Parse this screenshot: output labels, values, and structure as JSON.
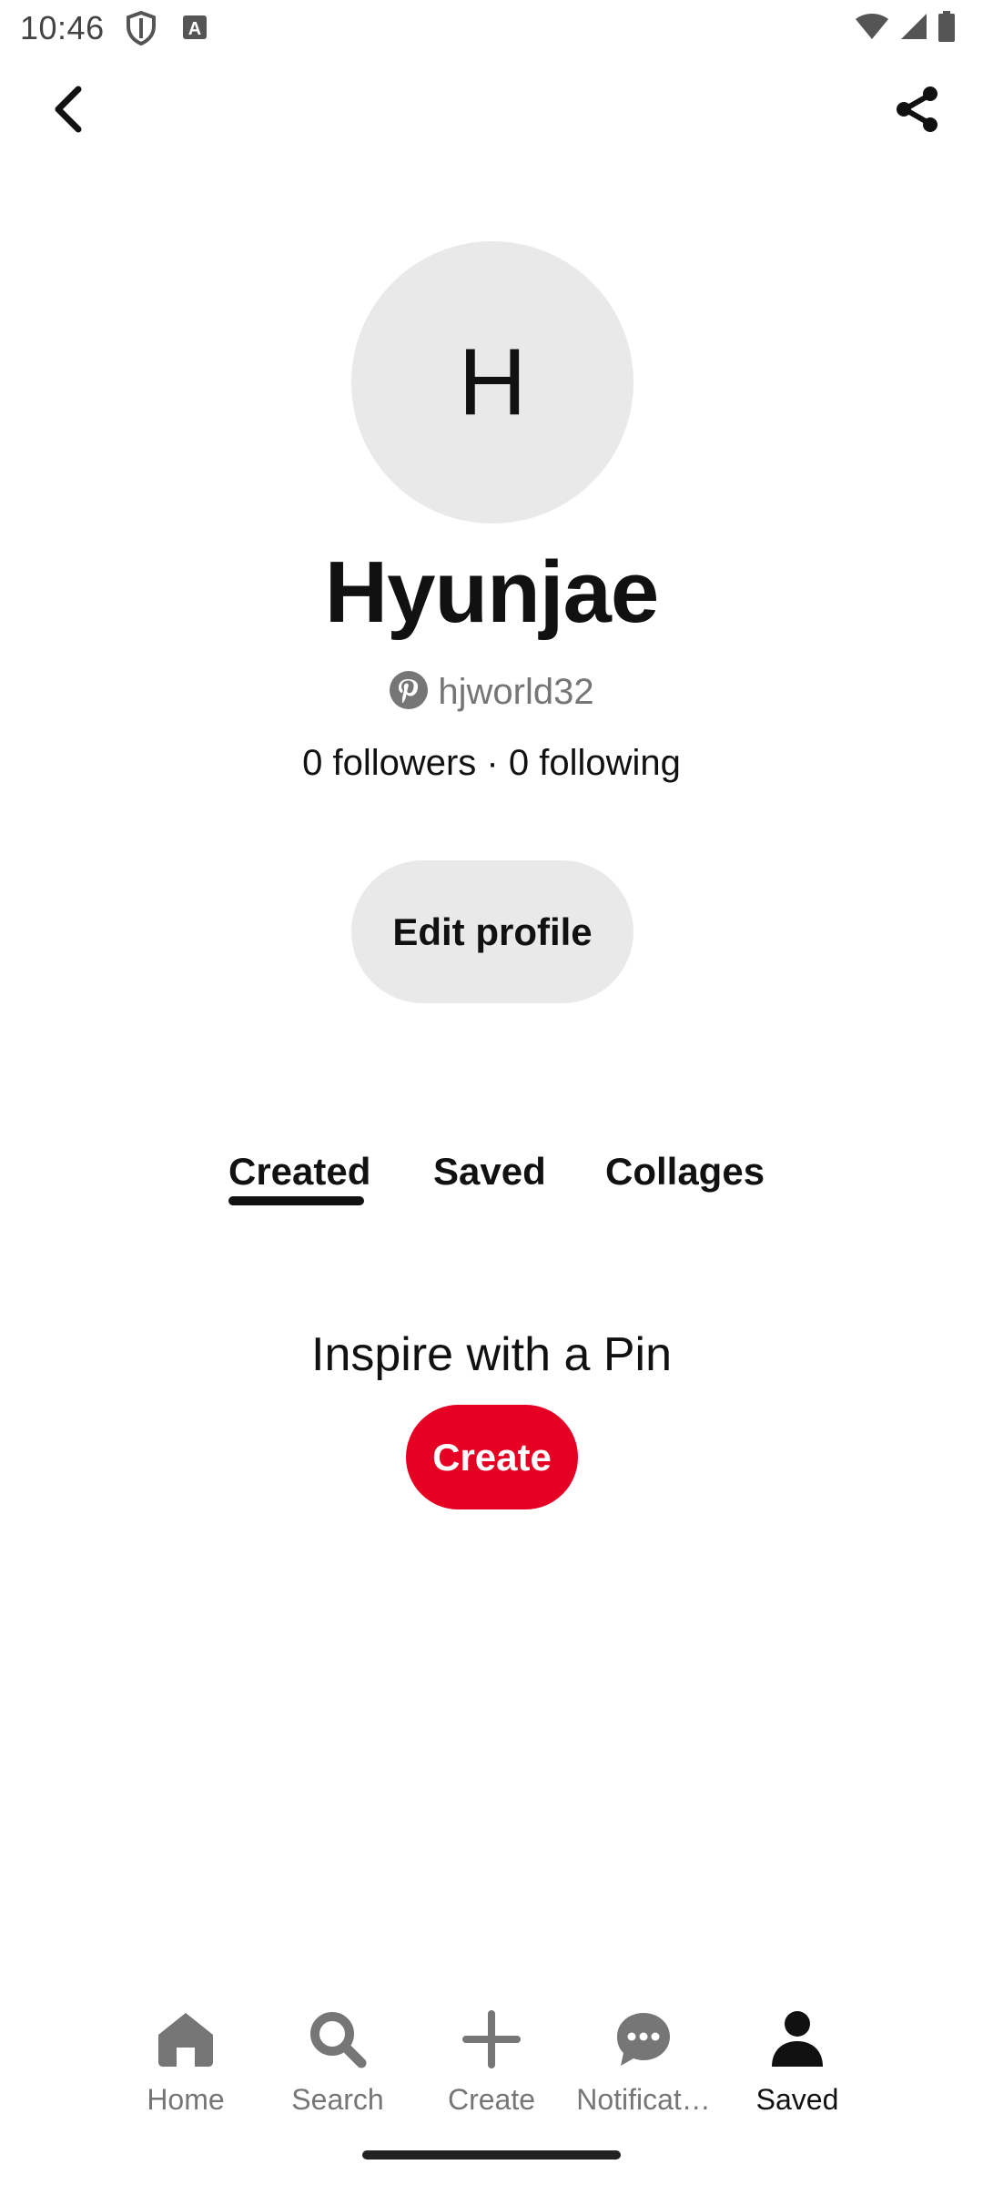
{
  "status_bar": {
    "time": "10:46"
  },
  "top_bar": {
    "back_icon": "chevron-left-icon",
    "share_icon": "share-icon"
  },
  "profile": {
    "avatar_initial": "H",
    "display_name": "Hyunjae",
    "username": "hjworld32",
    "followers": "0 followers",
    "separator": "·",
    "following": "0 following",
    "edit_label": "Edit profile"
  },
  "tabs": [
    {
      "label": "Created",
      "active": true
    },
    {
      "label": "Saved",
      "active": false
    },
    {
      "label": "Collages",
      "active": false
    }
  ],
  "empty_state": {
    "message": "Inspire with a Pin",
    "create_label": "Create"
  },
  "bottom_nav": [
    {
      "label": "Home",
      "icon": "home-icon",
      "active": false
    },
    {
      "label": "Search",
      "icon": "search-icon",
      "active": false
    },
    {
      "label": "Create",
      "icon": "plus-icon",
      "active": false
    },
    {
      "label": "Notificat…",
      "icon": "chat-bubble-icon",
      "active": false
    },
    {
      "label": "Saved",
      "icon": "person-icon",
      "active": true
    }
  ],
  "colors": {
    "accent_red": "#e60023",
    "chip_gray": "#e9e9e9",
    "text_primary": "#111111",
    "text_secondary": "#767676"
  }
}
